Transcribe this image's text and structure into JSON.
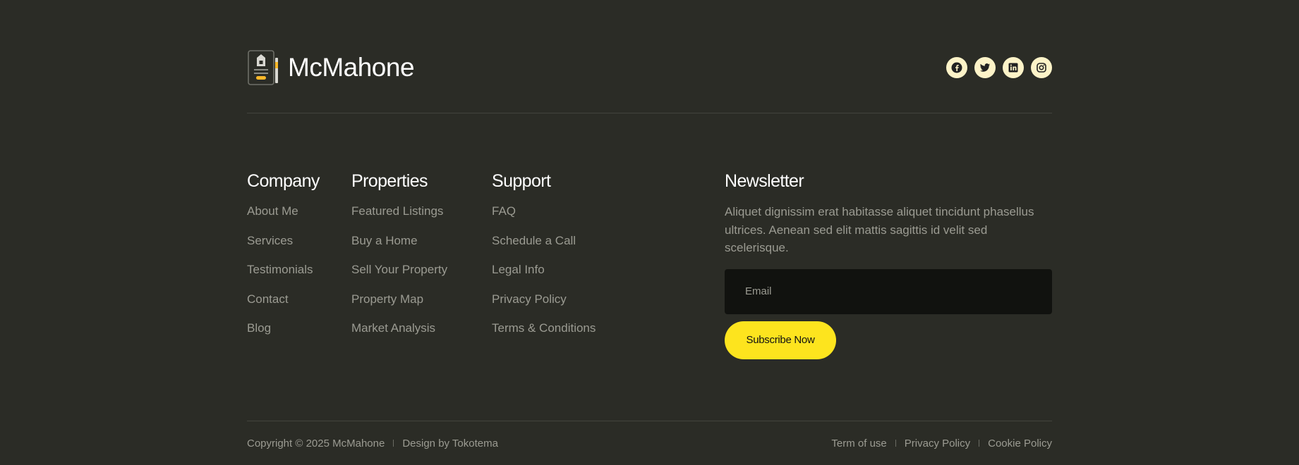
{
  "brand": {
    "name": "McMahone",
    "logo_icon": "notary-document-pen-icon"
  },
  "socials": [
    {
      "icon": "facebook-icon"
    },
    {
      "icon": "twitter-icon"
    },
    {
      "icon": "linkedin-icon"
    },
    {
      "icon": "instagram-icon"
    }
  ],
  "columns": {
    "company": {
      "title": "Company",
      "links": [
        "About Me",
        "Services",
        "Testimonials",
        "Contact",
        "Blog"
      ]
    },
    "properties": {
      "title": "Properties",
      "links": [
        "Featured Listings",
        "Buy a Home",
        "Sell Your Property",
        "Property Map",
        "Market Analysis"
      ]
    },
    "support": {
      "title": "Support",
      "links": [
        "FAQ",
        "Schedule a Call",
        "Legal Info",
        "Privacy Policy",
        "Terms & Conditions"
      ]
    }
  },
  "newsletter": {
    "title": "Newsletter",
    "text": "Aliquet dignissim erat habitasse aliquet tincidunt phasellus ultrices. Aenean sed elit mattis sagittis id velit sed scelerisque.",
    "email_placeholder": "Email",
    "button": "Subscribe Now"
  },
  "bottom": {
    "copyright": "Copyright © 2025 McMahone",
    "design": "Design by Tokotema",
    "links": [
      "Term of use",
      "Privacy Policy",
      "Cookie Policy"
    ]
  },
  "colors": {
    "background": "#2b2c26",
    "accent": "#fde41e",
    "social_bg": "#fdf3c8",
    "muted_text": "#9b9b92",
    "input_bg": "#11120f"
  }
}
